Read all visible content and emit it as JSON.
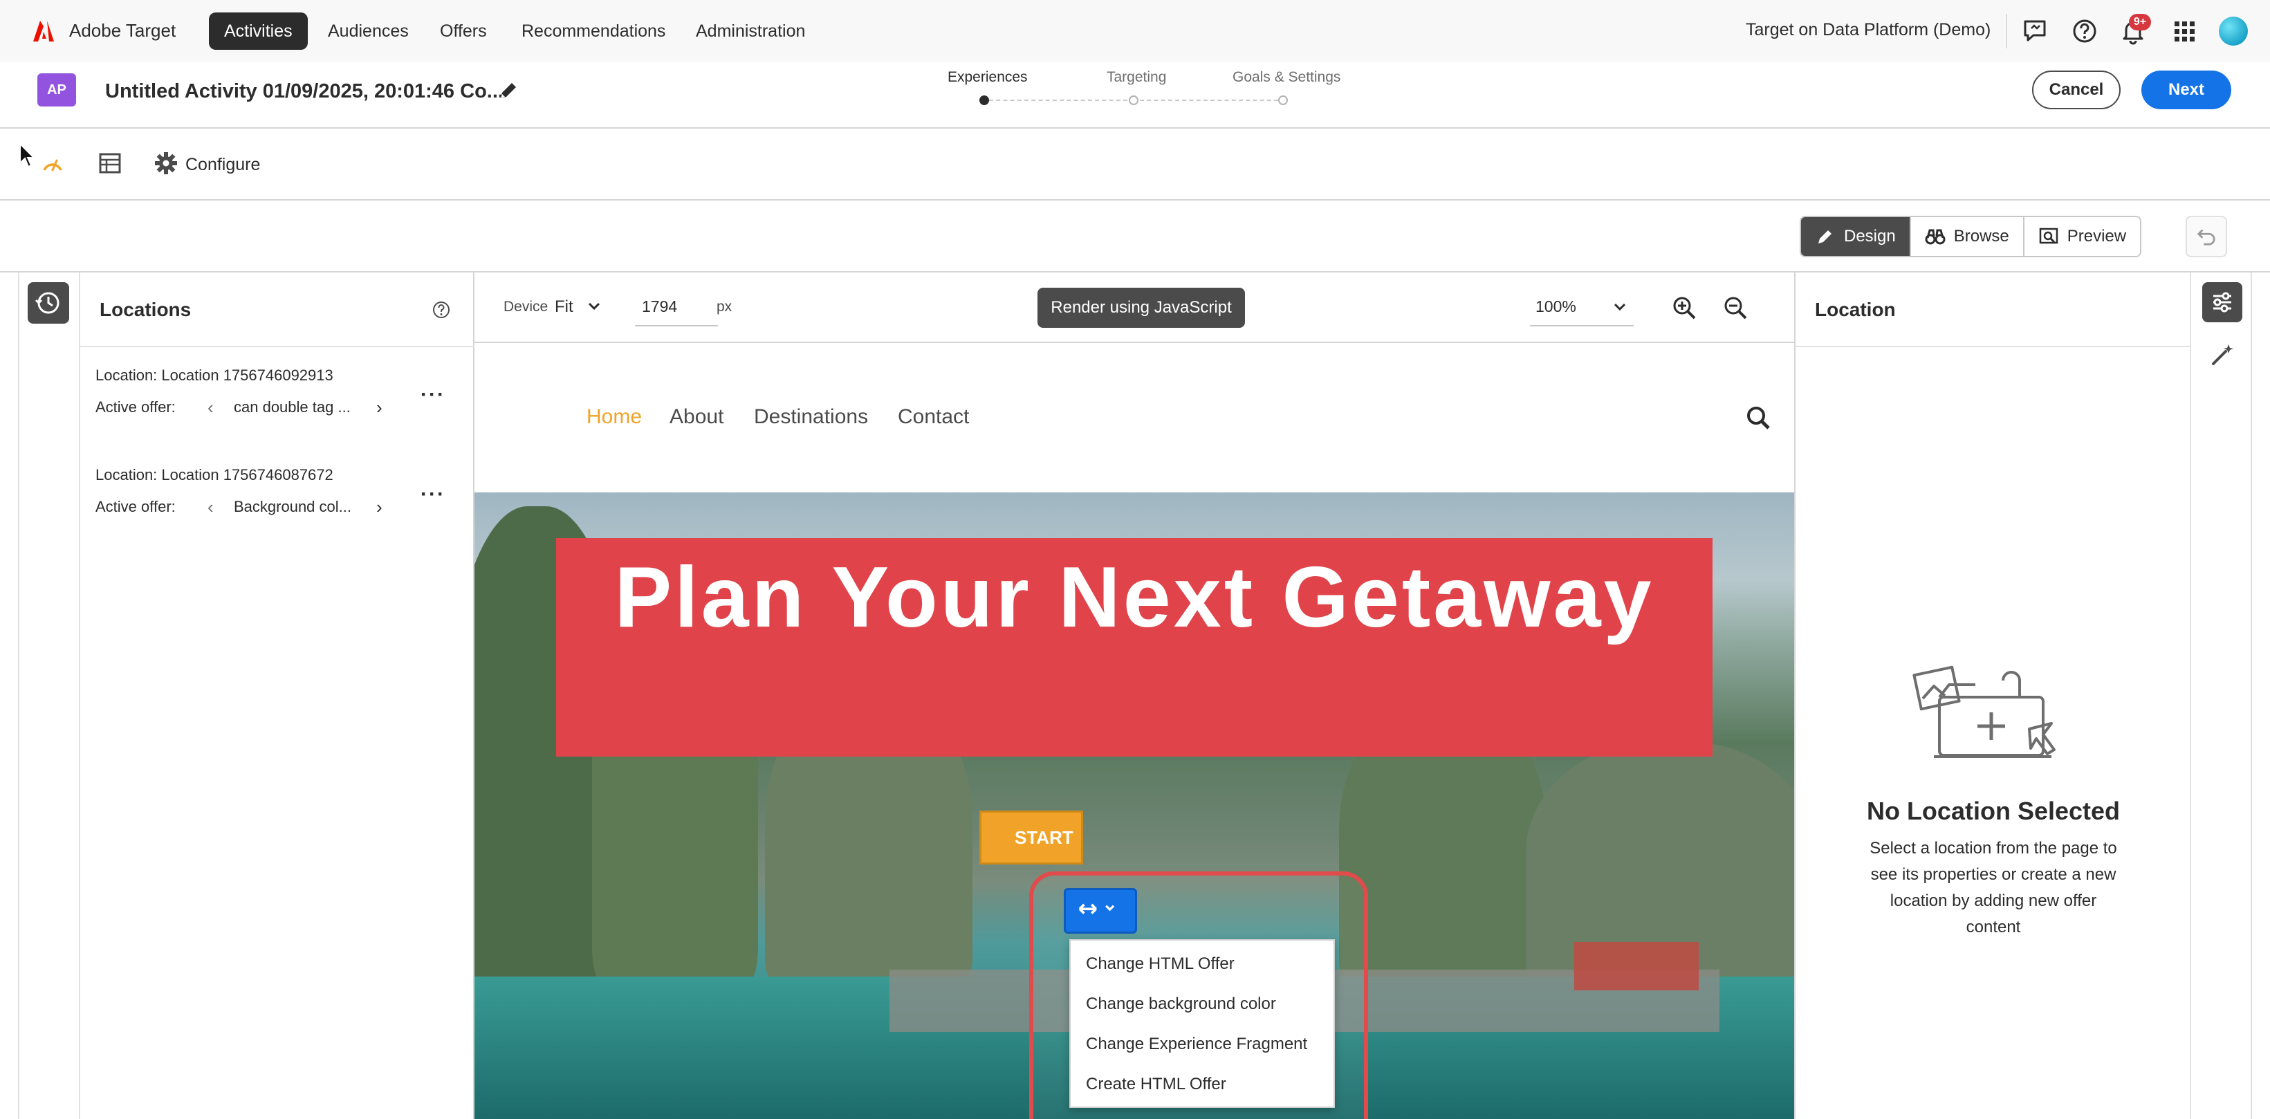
{
  "app": {
    "name": "Adobe Target",
    "org": "Target on Data Platform (Demo)",
    "notification_count": "9+",
    "nav": [
      {
        "label": "Activities",
        "active": true
      },
      {
        "label": "Audiences",
        "active": false
      },
      {
        "label": "Offers",
        "active": false
      },
      {
        "label": "Recommendations",
        "active": false
      },
      {
        "label": "Administration",
        "active": false
      }
    ]
  },
  "activity": {
    "badge": "AP",
    "title": "Untitled Activity 01/09/2025, 20:01:46 Co...",
    "steps": [
      {
        "label": "Experiences",
        "active": true
      },
      {
        "label": "Targeting",
        "active": false
      },
      {
        "label": "Goals & Settings",
        "active": false
      }
    ],
    "cancel_label": "Cancel",
    "next_label": "Next"
  },
  "toolbar": {
    "configure_label": "Configure"
  },
  "modes": {
    "design_label": "Design",
    "browse_label": "Browse",
    "preview_label": "Preview",
    "active": "Design"
  },
  "locations_panel": {
    "title": "Locations",
    "items": [
      {
        "name": "Location: Location 1756746092913",
        "offer_label": "Active offer:",
        "offer": "can double tag ..."
      },
      {
        "name": "Location: Location 1756746087672",
        "offer_label": "Active offer:",
        "offer": "Background col..."
      }
    ]
  },
  "canvas_toolbar": {
    "device_label": "Device",
    "device_value": "Fit",
    "width_value": "1794",
    "width_unit": "px",
    "render_label": "Render using JavaScript",
    "zoom_value": "100%"
  },
  "site": {
    "nav": [
      {
        "label": "Home",
        "active": true
      },
      {
        "label": "About",
        "active": false
      },
      {
        "label": "Destinations",
        "active": false
      },
      {
        "label": "Contact",
        "active": false
      }
    ],
    "hero_title": "Plan Your Next Getaway",
    "start_label": "START"
  },
  "context_menu": {
    "items": [
      "Change HTML Offer",
      "Change background color",
      "Change Experience Fragment",
      "Create HTML Offer"
    ]
  },
  "right_panel": {
    "title": "Location",
    "empty_title": "No Location Selected",
    "empty_desc": "Select a location from the page to see its properties or create a new location by adding new offer content"
  },
  "colors": {
    "accent_blue": "#1473e6",
    "adobe_red": "#eb1000",
    "highlight_red": "#e14b4b",
    "hero_banner": "#e0444a",
    "site_active": "#f0a328"
  }
}
